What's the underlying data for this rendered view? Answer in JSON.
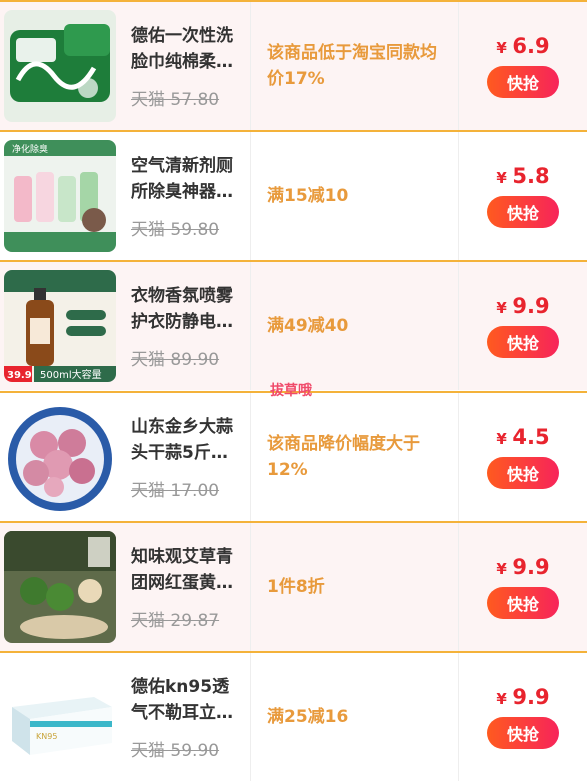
{
  "products": [
    {
      "title": "德佑一次性洗脸巾纯棉柔…",
      "original_price": "天猫 57.80",
      "promo": "该商品低于淘宝同款均价17%",
      "currency": "¥",
      "price": "6.9",
      "buy_label": "快抢",
      "thumb_icon": "face-towel-pack-image"
    },
    {
      "title": "空气清新剂厕所除臭神器…",
      "original_price": "天猫 59.80",
      "promo": "满15减10",
      "currency": "¥",
      "price": "5.8",
      "buy_label": "快抢",
      "thumb_icon": "air-freshener-bottles-image"
    },
    {
      "title": "衣物香氛喷雾护衣防静电…",
      "original_price": "天猫 89.90",
      "promo": "满49减40",
      "currency": "¥",
      "price": "9.9",
      "buy_label": "快抢",
      "thumb_icon": "fabric-spray-bottle-image"
    },
    {
      "title": "山东金乡大蒜头干蒜5斤…",
      "original_price": "天猫 17.00",
      "promo": "该商品降价幅度大于12%",
      "currency": "¥",
      "price": "4.5",
      "buy_label": "快抢",
      "thumb_icon": "garlic-bowl-image"
    },
    {
      "title": "知味观艾草青团网红蛋黄…",
      "original_price": "天猫 29.87",
      "promo": "1件8折",
      "currency": "¥",
      "price": "9.9",
      "buy_label": "快抢",
      "thumb_icon": "green-rice-ball-image"
    },
    {
      "title": "德佑kn95透气不勒耳立…",
      "original_price": "天猫 59.90",
      "promo": "满25减16",
      "currency": "¥",
      "price": "9.9",
      "buy_label": "快抢",
      "thumb_icon": "mask-box-image"
    }
  ],
  "overlay_text": "拔草哦",
  "thumb_texts": {
    "p2_tag": "净化除臭",
    "p3_badge": "39.9",
    "p3_volume": "500ml大容量",
    "p6_box": "KN95"
  },
  "colors": {
    "row_border": "#f4b23a",
    "promo_text": "#e89a3c",
    "price_red": "#e8242e",
    "button_gradient_start": "#ff5a1f",
    "button_gradient_end": "#f7245a",
    "row_alt_bg": "#fdf4f4"
  }
}
